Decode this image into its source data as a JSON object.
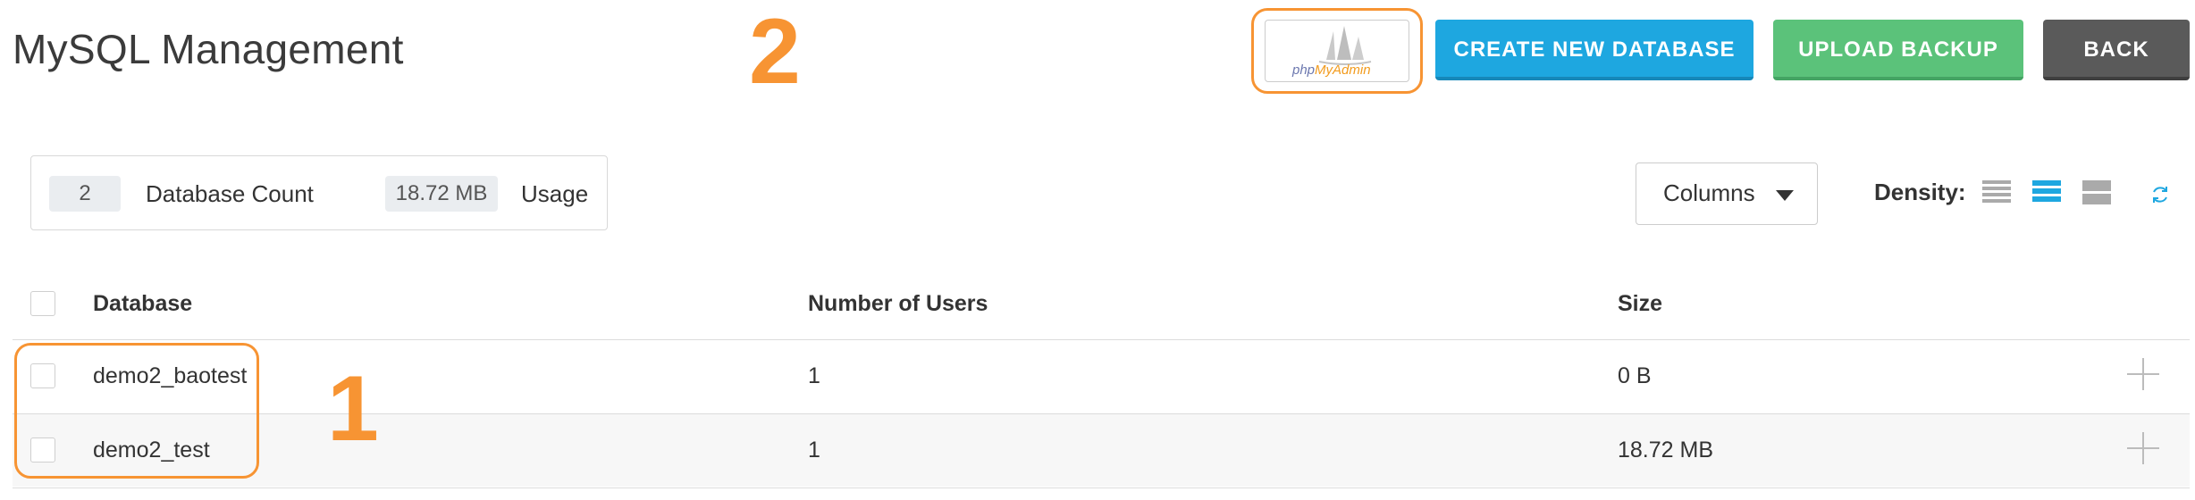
{
  "page": {
    "title": "MySQL Management"
  },
  "annotations": {
    "marker_1": "1",
    "marker_2": "2",
    "color": "#f79433"
  },
  "toolbar": {
    "phpmyadmin": {
      "php": "php",
      "myadmin": "MyAdmin",
      "icon": "phpmyadmin-sailboat-icon"
    },
    "create_label": "CREATE NEW DATABASE",
    "upload_label": "UPLOAD BACKUP",
    "back_label": "BACK"
  },
  "stats": {
    "count_value": "2",
    "count_label": "Database Count",
    "usage_value": "18.72 MB",
    "usage_label": "Usage"
  },
  "controls": {
    "columns_label": "Columns",
    "density_label": "Density:",
    "density_options": [
      "compact",
      "standard",
      "comfortable"
    ],
    "density_selected": "standard",
    "refresh_icon": "refresh-icon"
  },
  "table": {
    "headers": [
      "Database",
      "Number of Users",
      "Size"
    ],
    "rows": [
      {
        "database": "demo2_baotest",
        "users": "1",
        "size": "0 B"
      },
      {
        "database": "demo2_test",
        "users": "1",
        "size": "18.72 MB"
      }
    ]
  },
  "colors": {
    "accent_blue": "#1ea7e0",
    "upload_green": "#5bc27a",
    "back_gray": "#5a5a5a",
    "annotation_orange": "#f79433"
  }
}
